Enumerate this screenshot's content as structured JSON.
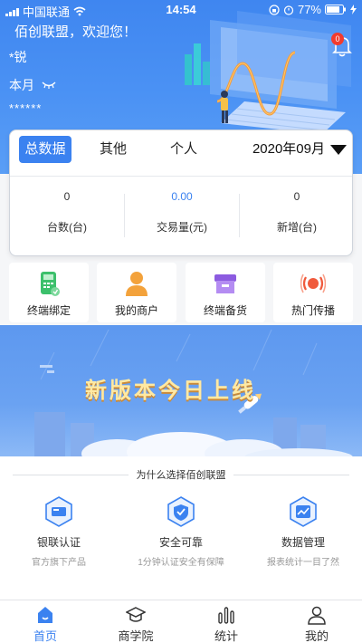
{
  "status_bar": {
    "carrier": "中国联通",
    "time": "14:54",
    "battery": "77%",
    "icons": [
      "signal-icon",
      "wifi-icon",
      "lock-rotation-icon",
      "alarm-icon",
      "battery-icon",
      "charging-icon"
    ]
  },
  "header": {
    "greeting": "佰创联盟，欢迎您！",
    "username": "*锐",
    "month_label": "本月",
    "masked_amount": "******",
    "notification_count": "0",
    "icons": [
      "eye-closed-icon",
      "bell-icon"
    ]
  },
  "stats": {
    "tabs": [
      {
        "label": "总数据",
        "active": true
      },
      {
        "label": "其他",
        "active": false
      },
      {
        "label": "个人",
        "active": false
      }
    ],
    "date": "2020年09月",
    "items": [
      {
        "value": "0",
        "label": "台数(台)"
      },
      {
        "value": "0.00",
        "label": "交易量(元)"
      },
      {
        "value": "0",
        "label": "新增(台)"
      }
    ]
  },
  "quick_actions": [
    {
      "label": "终端绑定",
      "icon": "pos-terminal-icon"
    },
    {
      "label": "我的商户",
      "icon": "merchant-person-icon"
    },
    {
      "label": "终端备货",
      "icon": "stock-box-icon"
    },
    {
      "label": "热门传播",
      "icon": "broadcast-icon"
    }
  ],
  "banner": {
    "text": "新版本今日上线"
  },
  "why": {
    "title": "为什么选择佰创联盟",
    "features": [
      {
        "title": "银联认证",
        "subtitle": "官方旗下产品",
        "icon": "unionpay-card-icon"
      },
      {
        "title": "安全可靠",
        "subtitle": "1分钟认证安全有保障",
        "icon": "shield-check-icon"
      },
      {
        "title": "数据管理",
        "subtitle": "报表统计一目了然",
        "icon": "data-chart-icon"
      }
    ]
  },
  "bottom_nav": [
    {
      "label": "首页",
      "icon": "home-icon",
      "active": true
    },
    {
      "label": "商学院",
      "icon": "graduation-cap-icon",
      "active": false
    },
    {
      "label": "统计",
      "icon": "bar-stats-icon",
      "active": false
    },
    {
      "label": "我的",
      "icon": "user-icon",
      "active": false
    }
  ],
  "colors": {
    "primary": "#3b82f0",
    "hero_top": "#3f86f0",
    "banner_text": "#ffe9a3",
    "badge": "#f23b2e"
  }
}
